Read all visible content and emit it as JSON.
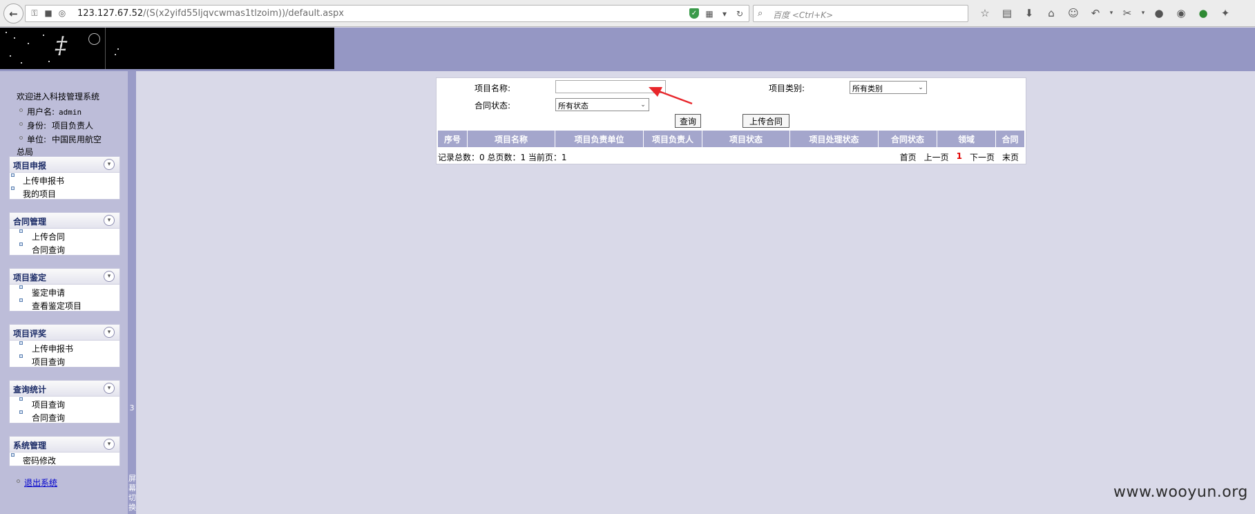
{
  "browser": {
    "url_host": "123.127.67.52",
    "url_path": "/(S(x2yifd55ljqvcwmas1tlzoim))/default.aspx",
    "search_placeholder": "百度 <Ctrl+K>"
  },
  "sidebar": {
    "welcome": "欢迎进入科技管理系统",
    "user_label": "用户名:",
    "user_value": "admin",
    "role_label": "身份:",
    "role_value": "项目负责人",
    "unit_label": "单位:",
    "unit_value_line1": "中国民用航空",
    "unit_value_line2": "总局",
    "strip_mark_top": "3",
    "strip_mark_bottom": [
      "屏",
      "幕",
      "切",
      "换"
    ],
    "panels": [
      {
        "title": "项目申报",
        "items": [
          "上传申报书",
          "我的项目"
        ]
      },
      {
        "title": "合同管理",
        "items": [
          "上传合同",
          "合同查询"
        ]
      },
      {
        "title": "项目鉴定",
        "items": [
          "鉴定申请",
          "查看鉴定项目"
        ]
      },
      {
        "title": "项目评奖",
        "items": [
          "上传申报书",
          "项目查询"
        ]
      },
      {
        "title": "查询统计",
        "items": [
          "项目查询",
          "合同查询"
        ]
      },
      {
        "title": "系统管理",
        "items": [
          "密码修改"
        ]
      }
    ],
    "logout": "退出系统"
  },
  "form": {
    "project_name_label": "项目名称:",
    "project_name_value": "",
    "project_type_label": "项目类别:",
    "project_type_value": "所有类别",
    "contract_status_label": "合同状态:",
    "contract_status_value": "所有状态",
    "query_button": "查询",
    "upload_contract_button": "上传合同"
  },
  "table": {
    "columns": [
      "序号",
      "项目名称",
      "项目负责单位",
      "项目负责人",
      "项目状态",
      "项目处理状态",
      "合同状态",
      "领域",
      "合同"
    ]
  },
  "summary": {
    "text": "记录总数：0 总页数：1 当前页：1"
  },
  "pager": {
    "first": "首页",
    "prev": "上一页",
    "current": "1",
    "next": "下一页",
    "last": "末页"
  },
  "watermark": "www.wooyun.org",
  "colors": {
    "banner": "#9597c4",
    "sidebar": "#bdbdd9",
    "table_header": "#a4a6cc",
    "page_bg": "#d9d9e8",
    "arrow": "#e8262b"
  }
}
